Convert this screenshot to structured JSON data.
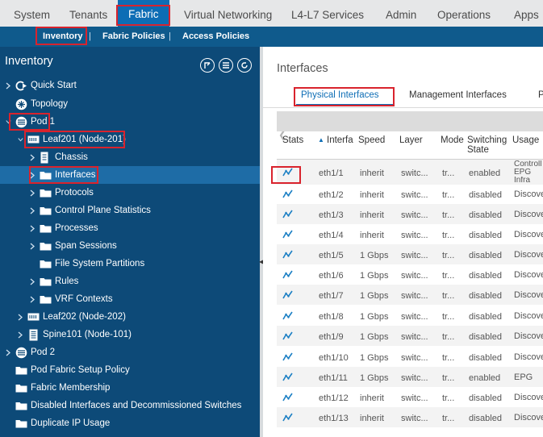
{
  "top_nav": {
    "tabs": [
      "System",
      "Tenants",
      "Fabric",
      "Virtual Networking",
      "L4-L7 Services",
      "Admin",
      "Operations",
      "Apps"
    ],
    "active": "Fabric"
  },
  "sub_nav": {
    "items": [
      "Inventory",
      "Fabric Policies",
      "Access Policies"
    ],
    "separator": "|",
    "active": "Inventory"
  },
  "sidebar": {
    "title": "Inventory",
    "tools": [
      "collapse-tree-icon",
      "list-icon",
      "refresh-icon"
    ],
    "tree": [
      {
        "label": "Quick Start",
        "icon": "quick-start-icon"
      },
      {
        "label": "Topology",
        "icon": "topology-icon"
      },
      {
        "label": "Pod 1",
        "icon": "pod-icon"
      },
      {
        "label": "Leaf201 (Node-201)",
        "icon": "leaf-switch-icon"
      },
      {
        "label": "Chassis",
        "icon": "chassis-icon"
      },
      {
        "label": "Interfaces",
        "icon": "folder-icon"
      },
      {
        "label": "Protocols",
        "icon": "folder-icon"
      },
      {
        "label": "Control Plane Statistics",
        "icon": "folder-icon"
      },
      {
        "label": "Processes",
        "icon": "folder-icon"
      },
      {
        "label": "Span Sessions",
        "icon": "folder-icon"
      },
      {
        "label": "File System Partitions",
        "icon": "folder-icon"
      },
      {
        "label": "Rules",
        "icon": "folder-icon"
      },
      {
        "label": "VRF Contexts",
        "icon": "folder-icon"
      },
      {
        "label": "Leaf202 (Node-202)",
        "icon": "leaf-switch-icon"
      },
      {
        "label": "Spine101 (Node-101)",
        "icon": "spine-switch-icon"
      },
      {
        "label": "Pod 2",
        "icon": "pod-icon"
      },
      {
        "label": "Pod Fabric Setup Policy",
        "icon": "folder-icon"
      },
      {
        "label": "Fabric Membership",
        "icon": "folder-icon"
      },
      {
        "label": "Disabled Interfaces and Decommissioned Switches",
        "icon": "folder-icon"
      },
      {
        "label": "Duplicate IP Usage",
        "icon": "folder-icon"
      }
    ]
  },
  "main": {
    "title": "Interfaces",
    "scroll_left": "❮",
    "tabs": [
      "Physical Interfaces",
      "Management Interfaces",
      "P"
    ],
    "active_tab": "Physical Interfaces",
    "columns": [
      "Stats",
      "Interfa",
      "Speed",
      "Layer",
      "Mode",
      "Switching State",
      "Usage"
    ],
    "column_lines": {
      "switching": [
        "Switching",
        "State"
      ]
    },
    "rows": [
      {
        "interface": "eth1/1",
        "speed": "inherit",
        "layer": "switc...",
        "mode": "tr...",
        "state": "enabled",
        "usage": [
          "Controll",
          "EPG",
          "Infra"
        ]
      },
      {
        "interface": "eth1/2",
        "speed": "inherit",
        "layer": "switc...",
        "mode": "tr...",
        "state": "disabled",
        "usage": [
          "Discove"
        ]
      },
      {
        "interface": "eth1/3",
        "speed": "inherit",
        "layer": "switc...",
        "mode": "tr...",
        "state": "disabled",
        "usage": [
          "Discove"
        ]
      },
      {
        "interface": "eth1/4",
        "speed": "inherit",
        "layer": "switc...",
        "mode": "tr...",
        "state": "disabled",
        "usage": [
          "Discove"
        ]
      },
      {
        "interface": "eth1/5",
        "speed": "1 Gbps",
        "layer": "switc...",
        "mode": "tr...",
        "state": "disabled",
        "usage": [
          "Discove"
        ]
      },
      {
        "interface": "eth1/6",
        "speed": "1 Gbps",
        "layer": "switc...",
        "mode": "tr...",
        "state": "disabled",
        "usage": [
          "Discove"
        ]
      },
      {
        "interface": "eth1/7",
        "speed": "1 Gbps",
        "layer": "switc...",
        "mode": "tr...",
        "state": "disabled",
        "usage": [
          "Discove"
        ]
      },
      {
        "interface": "eth1/8",
        "speed": "1 Gbps",
        "layer": "switc...",
        "mode": "tr...",
        "state": "disabled",
        "usage": [
          "Discove"
        ]
      },
      {
        "interface": "eth1/9",
        "speed": "1 Gbps",
        "layer": "switc...",
        "mode": "tr...",
        "state": "disabled",
        "usage": [
          "Discove"
        ]
      },
      {
        "interface": "eth1/10",
        "speed": "1 Gbps",
        "layer": "switc...",
        "mode": "tr...",
        "state": "disabled",
        "usage": [
          "Discove"
        ]
      },
      {
        "interface": "eth1/11",
        "speed": "1 Gbps",
        "layer": "switc...",
        "mode": "tr...",
        "state": "enabled",
        "usage": [
          "EPG"
        ]
      },
      {
        "interface": "eth1/12",
        "speed": "inherit",
        "layer": "switc...",
        "mode": "tr...",
        "state": "disabled",
        "usage": [
          "Discove"
        ]
      },
      {
        "interface": "eth1/13",
        "speed": "inherit",
        "layer": "switc...",
        "mode": "tr...",
        "state": "disabled",
        "usage": [
          "Discove"
        ]
      }
    ],
    "stats_icon": "stats-chart-icon",
    "accent": "#0d6db5",
    "highlight": "#d9232d"
  }
}
